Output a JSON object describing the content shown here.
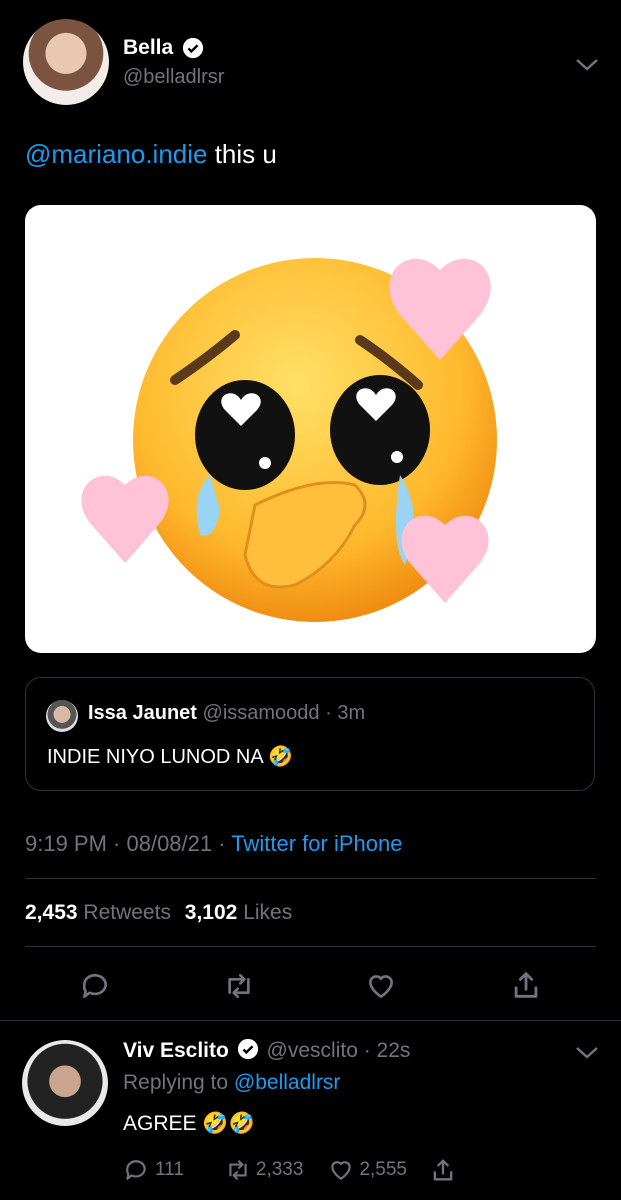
{
  "tweet": {
    "author_name": "Bella",
    "author_handle": "@belladlrsr",
    "mention": "@mariano.indie",
    "text": " this u",
    "quote": {
      "name": "Issa Jaunet",
      "handle": "@issamoodd",
      "time": "· 3m",
      "text": "INDIE NIYO LUNOD NA",
      "emoji": "🤣"
    },
    "time": "9:19 PM · 08/08/21 · ",
    "source": "Twitter for iPhone",
    "retweets_count": "2,453",
    "retweets_label": "Retweets",
    "likes_count": "3,102",
    "likes_label": "Likes"
  },
  "reply": {
    "author_name": "Viv Esclito",
    "author_handle": "@vesclito",
    "time": "· 22s",
    "replying_prefix": "Replying to ",
    "replying_handle": "@belladlrsr",
    "text": "AGREE",
    "emoji": "🤣🤣",
    "reply_count": "111",
    "retweet_count": "2,333",
    "like_count": "2,555"
  },
  "colors": {
    "background": "#000000",
    "link": "#1d9bf0",
    "muted": "#6e767d",
    "border": "#2f3336"
  },
  "icons": [
    "verified-icon",
    "chevron-down-icon",
    "reply-icon",
    "retweet-icon",
    "heart-icon",
    "share-icon"
  ]
}
